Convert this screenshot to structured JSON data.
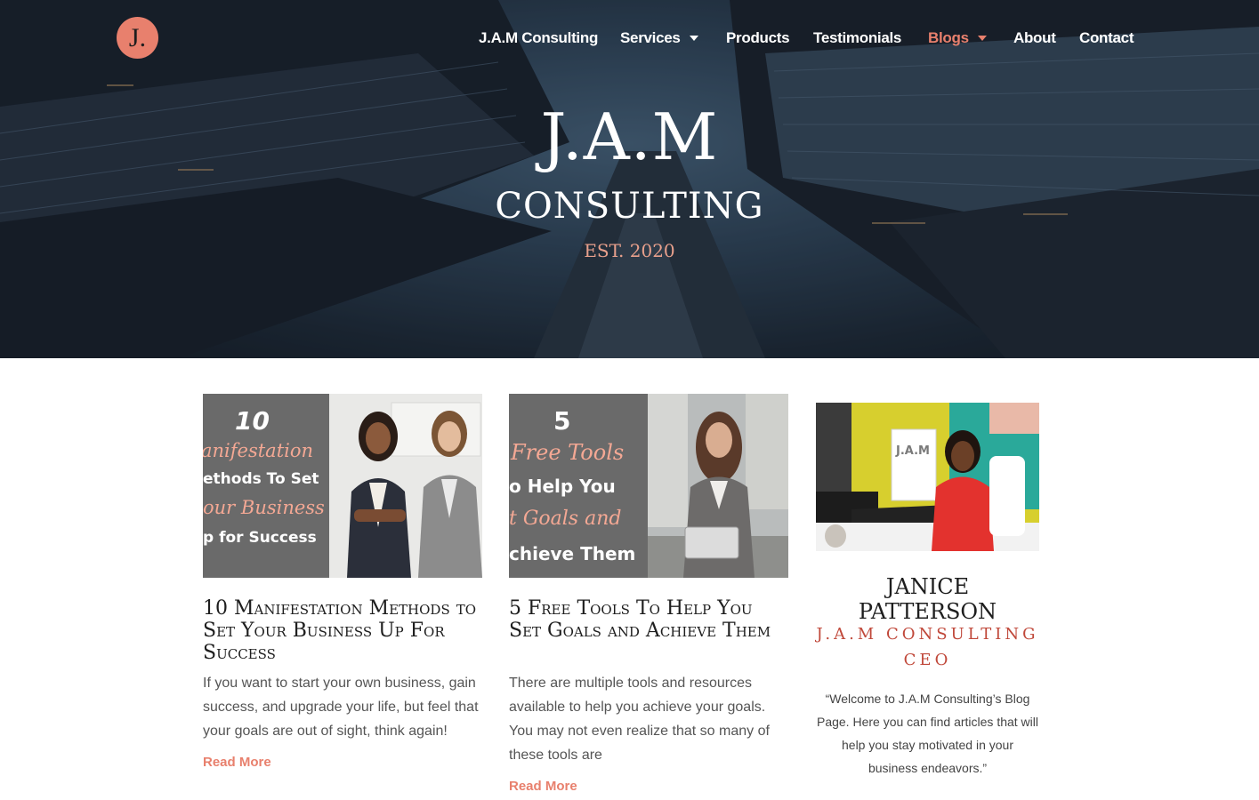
{
  "header": {
    "logo_text": "J.",
    "nav": [
      {
        "label": "J.A.M Consulting",
        "dropdown": false,
        "active": false
      },
      {
        "label": "Services",
        "dropdown": true,
        "active": false
      },
      {
        "label": "Products",
        "dropdown": false,
        "active": false
      },
      {
        "label": "Testimonials",
        "dropdown": false,
        "active": false
      },
      {
        "label": "Blogs",
        "dropdown": true,
        "active": true
      },
      {
        "label": "About",
        "dropdown": false,
        "active": false
      },
      {
        "label": "Contact",
        "dropdown": false,
        "active": false
      }
    ]
  },
  "hero": {
    "title": "J.A.M",
    "subtitle": "CONSULTING",
    "established": "EST. 2020"
  },
  "posts": [
    {
      "image_lines": [
        "10",
        "anifestation",
        "ethods To Set",
        "our Business",
        "p for Success"
      ],
      "title": "10 Manifestation Methods to Set Your Business Up For Success",
      "excerpt": "If you want to start your own business, gain success, and upgrade your life, but feel that your goals are out of sight, think again!",
      "read_more": "Read More"
    },
    {
      "image_lines": [
        "5",
        "Free Tools",
        "o Help You",
        "t Goals and",
        "chieve Them"
      ],
      "title": "5 Free Tools To Help You Set Goals and Achieve Them",
      "excerpt": "There are multiple tools and resources available to help you achieve your goals. You may not even realize that so many of these tools are",
      "read_more": "Read More"
    }
  ],
  "profile": {
    "name": "JANICE PATTERSON",
    "role_line1": "J.A.M CONSULTING",
    "role_line2": "CEO",
    "quote": "“Welcome to J.A.M Consulting’s Blog Page. Here you can find articles that will help you stay motivated in your business endeavors.”",
    "photo_sign": "J.A.M"
  },
  "colors": {
    "accent": "#e8806d",
    "hero_dark": "#1f2c3a",
    "role_red": "#c0483a",
    "text_dark": "#1e1e1e",
    "text_body": "#555555"
  }
}
